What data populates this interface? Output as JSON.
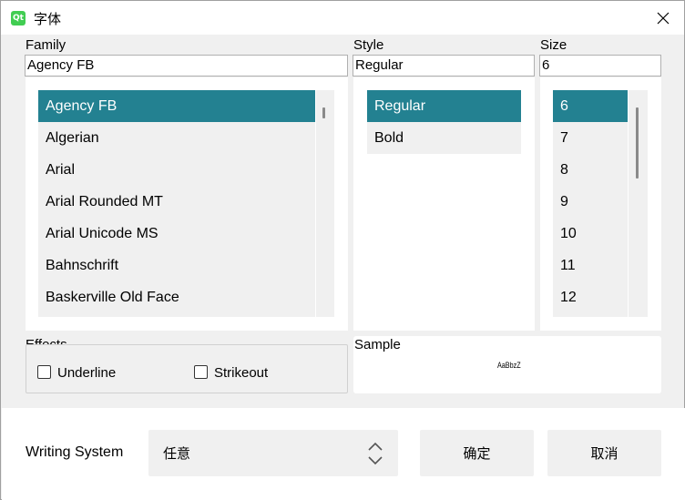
{
  "window": {
    "title": "字体",
    "app_icon_text": "Qt"
  },
  "family": {
    "label": "Family",
    "value": "Agency FB",
    "items": [
      "Agency FB",
      "Algerian",
      "Arial",
      "Arial Rounded MT",
      "Arial Unicode MS",
      "Bahnschrift",
      "Baskerville Old Face"
    ],
    "selected_index": 0
  },
  "style": {
    "label": "Style",
    "value": "Regular",
    "items": [
      "Regular",
      "Bold"
    ],
    "selected_index": 0
  },
  "size": {
    "label": "Size",
    "value": "6",
    "items": [
      "6",
      "7",
      "8",
      "9",
      "10",
      "11",
      "12"
    ],
    "selected_index": 0
  },
  "effects": {
    "label": "Effects",
    "underline_label": "Underline",
    "strikeout_label": "Strikeout",
    "underline_checked": false,
    "strikeout_checked": false
  },
  "sample": {
    "label": "Sample",
    "text": "AaBbzZ"
  },
  "writing_system": {
    "label": "Writing System",
    "value": "任意"
  },
  "buttons": {
    "ok": "确定",
    "cancel": "取消"
  },
  "colors": {
    "selection": "#238191",
    "panel": "#f0f0f0"
  }
}
